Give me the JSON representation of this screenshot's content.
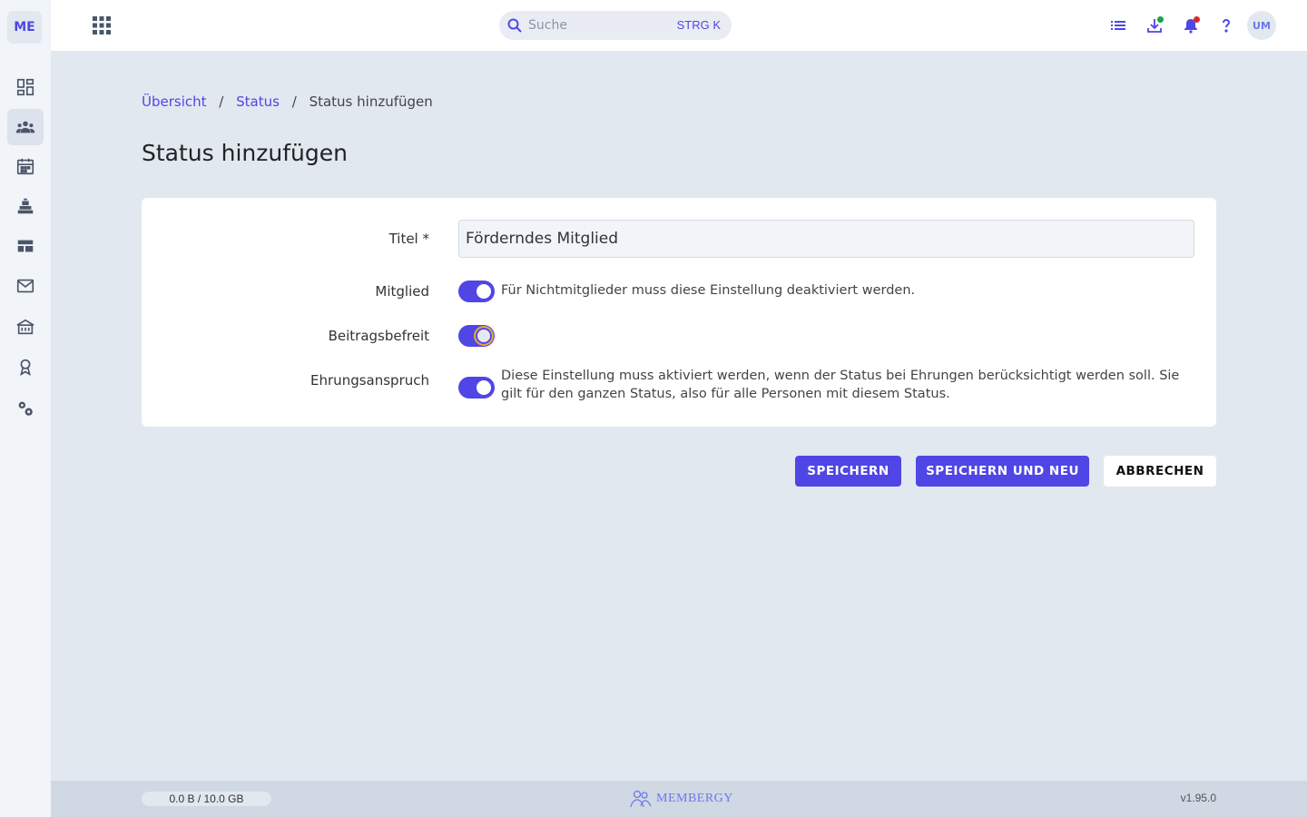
{
  "sidebar": {
    "logo": "ME",
    "items": [
      {
        "icon": "dashboard-icon"
      },
      {
        "icon": "people-icon",
        "active": true
      },
      {
        "icon": "calendar-icon"
      },
      {
        "icon": "inventory-icon"
      },
      {
        "icon": "table-icon"
      },
      {
        "icon": "mail-icon"
      },
      {
        "icon": "building-icon"
      },
      {
        "icon": "award-icon"
      },
      {
        "icon": "settings-icon"
      }
    ]
  },
  "topbar": {
    "search_placeholder": "Suche",
    "search_shortcut": "STRG K",
    "avatar_initials": "UM",
    "download_dot_color": "#16a34a",
    "bell_dot_color": "#dc2626"
  },
  "breadcrumb": {
    "items": [
      "Übersicht",
      "Status",
      "Status hinzufügen"
    ],
    "separator": "/"
  },
  "page": {
    "title": "Status hinzufügen"
  },
  "form": {
    "title_label": "Titel *",
    "title_value": "Förderndes Mitglied",
    "mitglied_label": "Mitglied",
    "mitglied_on": true,
    "mitglied_hint": "Für Nichtmitglieder muss diese Einstellung deaktiviert werden.",
    "beitragsbefreit_label": "Beitragsbefreit",
    "beitragsbefreit_on": true,
    "ehrung_label": "Ehrungsanspruch",
    "ehrung_on": true,
    "ehrung_hint": "Diese Einstellung muss aktiviert werden, wenn der Status bei Ehrungen berücksichtigt werden soll. Sie gilt für den ganzen Status, also für alle Personen mit diesem Status."
  },
  "actions": {
    "save": "SPEICHERN",
    "save_new": "SPEICHERN UND NEU",
    "cancel": "ABBRECHEN"
  },
  "footer": {
    "storage": "0.0 B / 10.0 GB",
    "brand": "MEMBERGY",
    "version": "v1.95.0"
  },
  "colors": {
    "accent": "#4f46e5",
    "background": "#e2e8f0"
  }
}
